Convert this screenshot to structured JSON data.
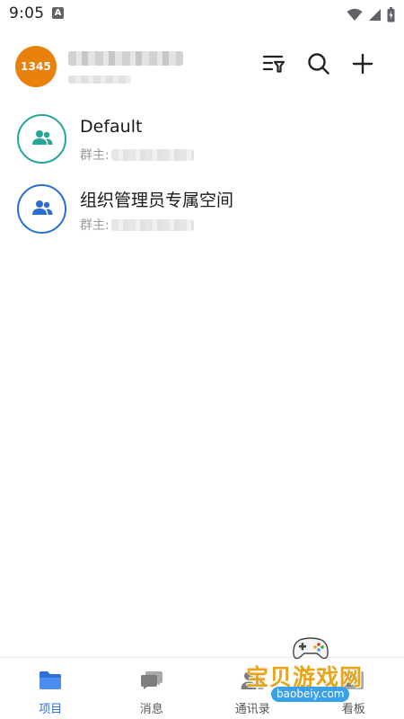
{
  "status_bar": {
    "time": "9:05"
  },
  "header": {
    "avatar_text": "1345"
  },
  "projects": [
    {
      "title": "Default",
      "owner_label": "群主:",
      "icon_color": "#26a69a"
    },
    {
      "title": "组织管理员专属空间",
      "owner_label": "群主:",
      "icon_color": "#2a6ed0"
    }
  ],
  "tabs": [
    {
      "label": "项目",
      "icon": "folder-icon"
    },
    {
      "label": "消息",
      "icon": "chat-icon"
    },
    {
      "label": "通讯录",
      "icon": "contacts-icon"
    },
    {
      "label": "看板",
      "icon": "board-icon"
    }
  ],
  "watermark": {
    "text": "宝贝游戏网",
    "url": "baobeiy.com"
  },
  "colors": {
    "accent": "#2f6fd6",
    "avatar": "#e8820c",
    "teal": "#26a69a"
  }
}
